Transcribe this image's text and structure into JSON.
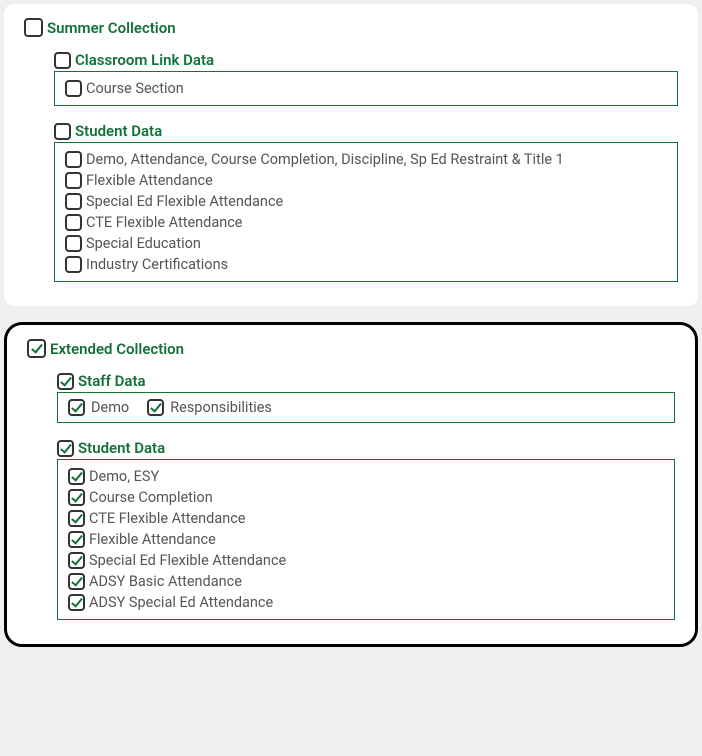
{
  "collections": [
    {
      "id": "summer",
      "title": "Summer Collection",
      "checked": false,
      "highlighted": false,
      "groups": [
        {
          "id": "classroom-link",
          "title": "Classroom Link Data",
          "checked": false,
          "layout": "vertical",
          "items": [
            {
              "label": "Course Section",
              "checked": false
            }
          ]
        },
        {
          "id": "student-data",
          "title": "Student Data",
          "checked": false,
          "layout": "vertical",
          "items": [
            {
              "label": "Demo, Attendance, Course Completion, Discipline, Sp Ed Restraint & Title 1",
              "checked": false
            },
            {
              "label": "Flexible Attendance",
              "checked": false
            },
            {
              "label": "Special Ed Flexible Attendance",
              "checked": false
            },
            {
              "label": "CTE Flexible Attendance",
              "checked": false
            },
            {
              "label": "Special Education",
              "checked": false
            },
            {
              "label": "Industry Certifications",
              "checked": false
            }
          ]
        }
      ]
    },
    {
      "id": "extended",
      "title": "Extended Collection",
      "checked": true,
      "highlighted": true,
      "groups": [
        {
          "id": "staff-data",
          "title": "Staff Data",
          "checked": true,
          "layout": "horizontal",
          "items": [
            {
              "label": "Demo",
              "checked": true
            },
            {
              "label": "Responsibilities",
              "checked": true
            }
          ]
        },
        {
          "id": "student-data-ext",
          "title": "Student Data",
          "checked": true,
          "layout": "vertical",
          "items": [
            {
              "label": "Demo, ESY",
              "checked": true
            },
            {
              "label": "Course Completion",
              "checked": true
            },
            {
              "label": "CTE Flexible Attendance",
              "checked": true
            },
            {
              "label": "Flexible Attendance",
              "checked": true
            },
            {
              "label": "Special Ed Flexible Attendance",
              "checked": true
            },
            {
              "label": "ADSY Basic Attendance",
              "checked": true
            },
            {
              "label": "ADSY Special Ed Attendance",
              "checked": true
            }
          ]
        }
      ]
    }
  ]
}
